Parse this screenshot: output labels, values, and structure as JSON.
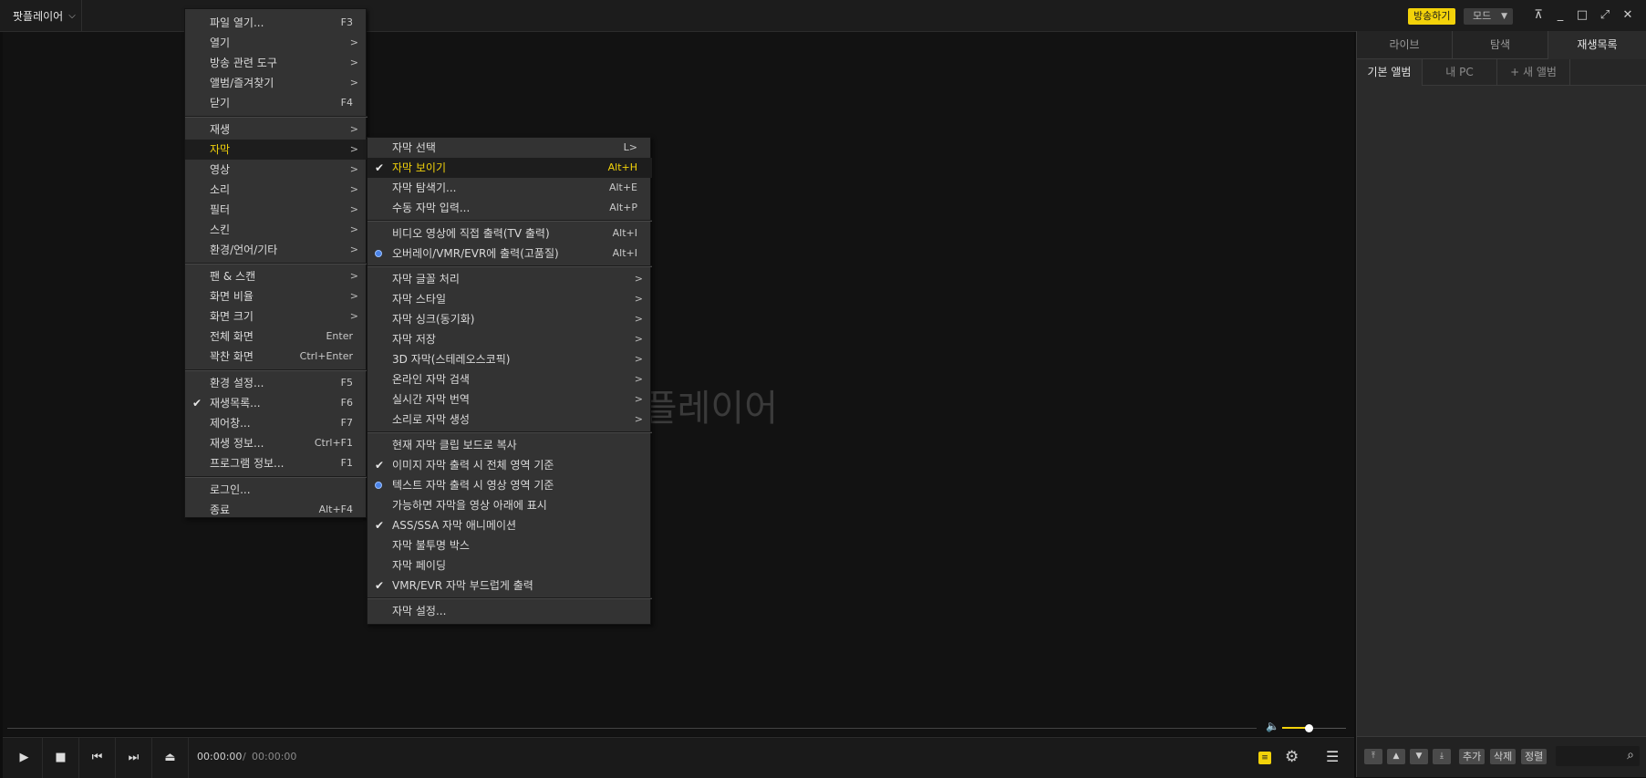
{
  "app": {
    "title": "팟플레이어",
    "watermark": "팟플레이어",
    "broadcast_label": "방송하기",
    "mode_label": "모드",
    "accent": "#f2d20a"
  },
  "window_controls": {
    "pin_icon": "pin-icon",
    "minimize_icon": "minimize-icon",
    "maximize_icon": "maximize-icon",
    "fullscreen_icon": "fullscreen-icon",
    "close_icon": "close-icon"
  },
  "panel": {
    "tabs": [
      "라이브",
      "탐색",
      "재생목록"
    ],
    "active_tab": "재생목록",
    "subtabs": [
      "기본 앨범",
      "내 PC",
      "+ 새 앨범"
    ],
    "active_subtab": "기본 앨범",
    "toolbar": {
      "add": "추가",
      "delete": "삭제",
      "sort": "정렬"
    }
  },
  "controls": {
    "time_current": "00:00:00",
    "time_sep": "/",
    "time_total": "00:00:00",
    "volume_level": 0.42
  },
  "main_menu": {
    "items": [
      {
        "label": "파일 열기...",
        "key": "F3"
      },
      {
        "label": "열기",
        "sub": ">"
      },
      {
        "label": "방송 관련 도구",
        "sub": ">"
      },
      {
        "label": "앨범/즐겨찾기",
        "sub": ">"
      },
      {
        "label": "닫기",
        "key": "F4"
      },
      {
        "label": "재생",
        "sub": ">"
      },
      {
        "label": "자막",
        "sub": ">"
      },
      {
        "label": "영상",
        "sub": ">"
      },
      {
        "label": "소리",
        "sub": ">"
      },
      {
        "label": "필터",
        "sub": ">"
      },
      {
        "label": "스킨",
        "sub": ">"
      },
      {
        "label": "환경/언어/기타",
        "sub": ">"
      },
      {
        "label": "팬 & 스캔",
        "sub": ">"
      },
      {
        "label": "화면 비율",
        "sub": ">"
      },
      {
        "label": "화면 크기",
        "sub": ">"
      },
      {
        "label": "전체 화면",
        "key": "Enter"
      },
      {
        "label": "꽉찬 화면",
        "key": "Ctrl+Enter"
      },
      {
        "label": "환경 설정...",
        "key": "F5"
      },
      {
        "label": "재생목록...",
        "key": "F6",
        "checked": true
      },
      {
        "label": "제어창...",
        "key": "F7"
      },
      {
        "label": "재생 정보...",
        "key": "Ctrl+F1"
      },
      {
        "label": "프로그램 정보...",
        "key": "F1"
      },
      {
        "label": "로그인..."
      },
      {
        "label": "종료",
        "key": "Alt+F4"
      }
    ]
  },
  "subtitle_menu": {
    "items": [
      {
        "label": "자막 선택",
        "key": "L>"
      },
      {
        "label": "자막 보이기",
        "key": "Alt+H",
        "checked": true
      },
      {
        "label": "자막 탐색기...",
        "key": "Alt+E"
      },
      {
        "label": "수동 자막 입력...",
        "key": "Alt+P"
      },
      {
        "label": "비디오 영상에 직접 출력(TV 출력)",
        "key": "Alt+I"
      },
      {
        "label": "오버레이/VMR/EVR에 출력(고품질)",
        "key": "Alt+I",
        "radio": true
      },
      {
        "label": "자막 글꼴 처리",
        "sub": ">"
      },
      {
        "label": "자막 스타일",
        "sub": ">"
      },
      {
        "label": "자막 싱크(동기화)",
        "sub": ">"
      },
      {
        "label": "자막 저장",
        "sub": ">"
      },
      {
        "label": "3D 자막(스테레오스코픽)",
        "sub": ">"
      },
      {
        "label": "온라인 자막 검색",
        "sub": ">"
      },
      {
        "label": "실시간 자막 번역",
        "sub": ">"
      },
      {
        "label": "소리로 자막 생성",
        "sub": ">"
      },
      {
        "label": "현재 자막 클립 보드로 복사"
      },
      {
        "label": "이미지 자막 출력 시 전체 영역 기준",
        "checked": true
      },
      {
        "label": "텍스트 자막 출력 시 영상 영역 기준",
        "radio": true
      },
      {
        "label": "가능하면 자막을 영상 아래에 표시"
      },
      {
        "label": "ASS/SSA 자막 애니메이션",
        "checked": true
      },
      {
        "label": "자막 불투명 박스"
      },
      {
        "label": "자막 페이딩"
      },
      {
        "label": "VMR/EVR 자막 부드럽게 출력",
        "checked": true
      },
      {
        "label": "자막 설정..."
      }
    ]
  }
}
